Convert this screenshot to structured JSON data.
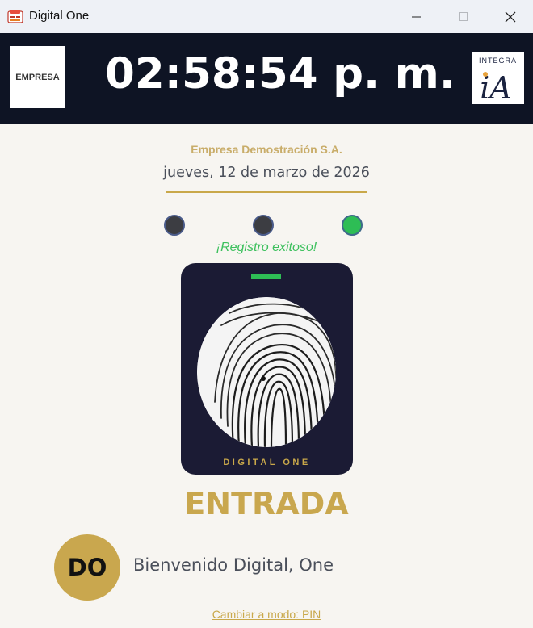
{
  "window": {
    "title": "Digital One",
    "app_icon": "app-icon",
    "controls": [
      "minimize-icon",
      "maximize-icon",
      "close-icon"
    ]
  },
  "header": {
    "company_logo_text": "EMPRESA",
    "clock": "02:58:54 p. m.",
    "integra_logo_text": "INTEGRA",
    "integra_logo_mark": "iA"
  },
  "main": {
    "company_name": "Empresa Demostración S.A.",
    "date": "jueves, 12 de marzo de 2026",
    "status_dots": [
      "idle",
      "idle",
      "success"
    ],
    "status_message": "¡Registro exitoso!",
    "scanner_brand": "DIGITAL ONE",
    "mode": "ENTRADA",
    "user_initials": "DO",
    "welcome_message": "Bienvenido Digital, One",
    "switch_mode_link": "Cambiar a modo: PIN"
  },
  "colors": {
    "header_bg": "#0e1424",
    "accent_gold": "#c9a74e",
    "success_green": "#2ebd55",
    "scanner_bg": "#1b1b34",
    "page_bg": "#f7f5f1"
  }
}
